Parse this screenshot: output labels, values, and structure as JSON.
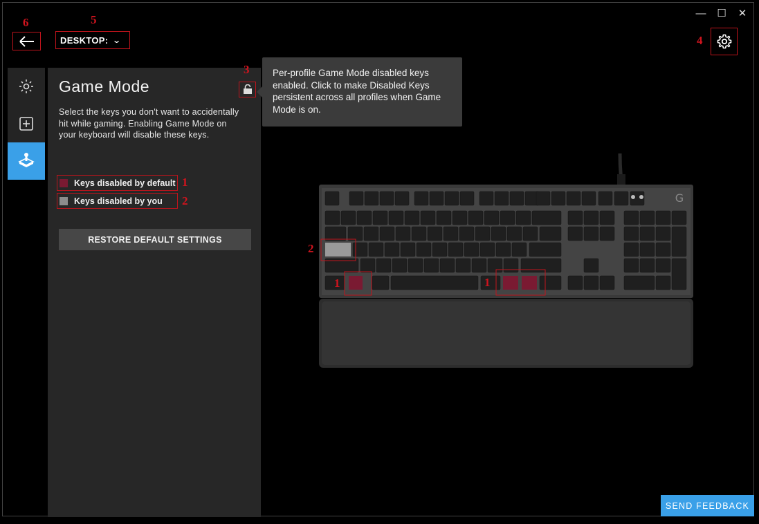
{
  "window": {
    "minimize_glyph": "—",
    "maximize_glyph": "☐",
    "close_glyph": "✕"
  },
  "header": {
    "profile_label": "DESKTOP:",
    "chevron": "⌄"
  },
  "panel": {
    "title": "Game Mode",
    "description": "Select the keys you don't want to accidentally hit while gaming. Enabling Game Mode on your keyboard will disable these keys.",
    "legend": [
      {
        "label": "Keys disabled by default",
        "color": "#7a1a32"
      },
      {
        "label": "Keys disabled by you",
        "color": "#8c8c8c"
      }
    ],
    "restore_label": "RESTORE DEFAULT SETTINGS"
  },
  "tooltip": {
    "text": "Per-profile Game Mode disabled keys enabled. Click to make Disabled Keys persistent across all profiles when Game Mode is on."
  },
  "rail": {
    "items": [
      {
        "icon": "lighting-icon",
        "active": false
      },
      {
        "icon": "assignments-icon",
        "active": false
      },
      {
        "icon": "game-mode-icon",
        "active": true
      }
    ]
  },
  "footer": {
    "feedback_label": "SEND FEEDBACK"
  },
  "annotations": {
    "n1": "1",
    "n2": "2",
    "n3": "3",
    "n4": "4",
    "n5": "5",
    "n6": "6"
  },
  "keyboard": {
    "brand_logo": "G",
    "disabled_default_color": "#7a1a32",
    "disabled_user_color": "#9a9a9a"
  },
  "colors": {
    "accent": "#3aa0e8",
    "annotation": "#c0141c",
    "panel_bg": "#272727"
  }
}
